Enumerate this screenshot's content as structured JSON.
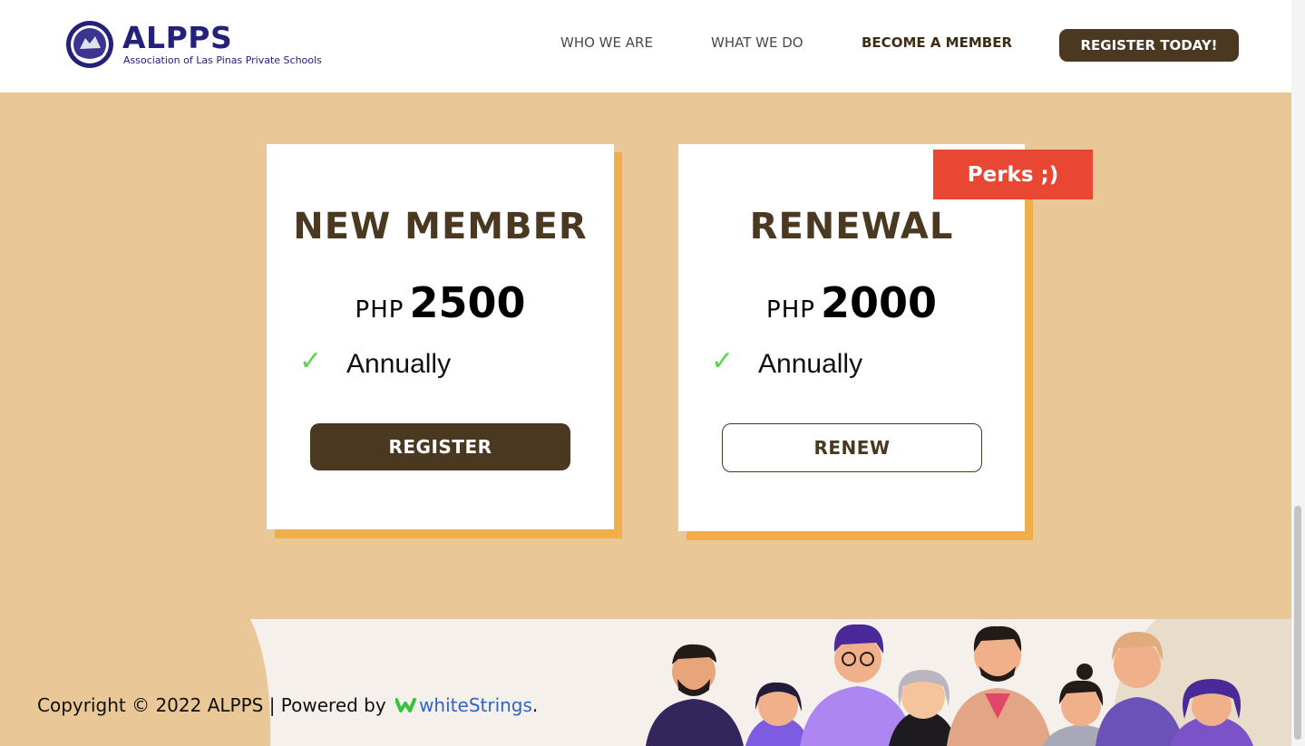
{
  "header": {
    "logo_title": "ALPPS",
    "logo_subtitle": "Association of Las Pinas Private Schools",
    "nav": [
      "WHO WE ARE",
      "WHAT WE DO",
      "BECOME A MEMBER"
    ],
    "cta_label": "REGISTER TODAY!"
  },
  "plans": [
    {
      "title": "NEW MEMBER",
      "currency": "PHP",
      "amount": "2500",
      "feature": "Annually",
      "button": "REGISTER"
    },
    {
      "title": "RENEWAL",
      "currency": "PHP",
      "amount": "2000",
      "feature": "Annually",
      "button": "RENEW",
      "ribbon": "Perks ;)"
    }
  ],
  "footer": {
    "copyright": "Copyright © 2022 ALPPS | Powered by",
    "brand": "whiteStrings",
    "brand_suffix": "."
  },
  "colors": {
    "background": "#e9c796",
    "brand_dark": "#4b3821",
    "brand_blue": "#25207a",
    "accent_shadow": "#efae4a",
    "ribbon": "#e84734",
    "check": "#56d84a"
  }
}
